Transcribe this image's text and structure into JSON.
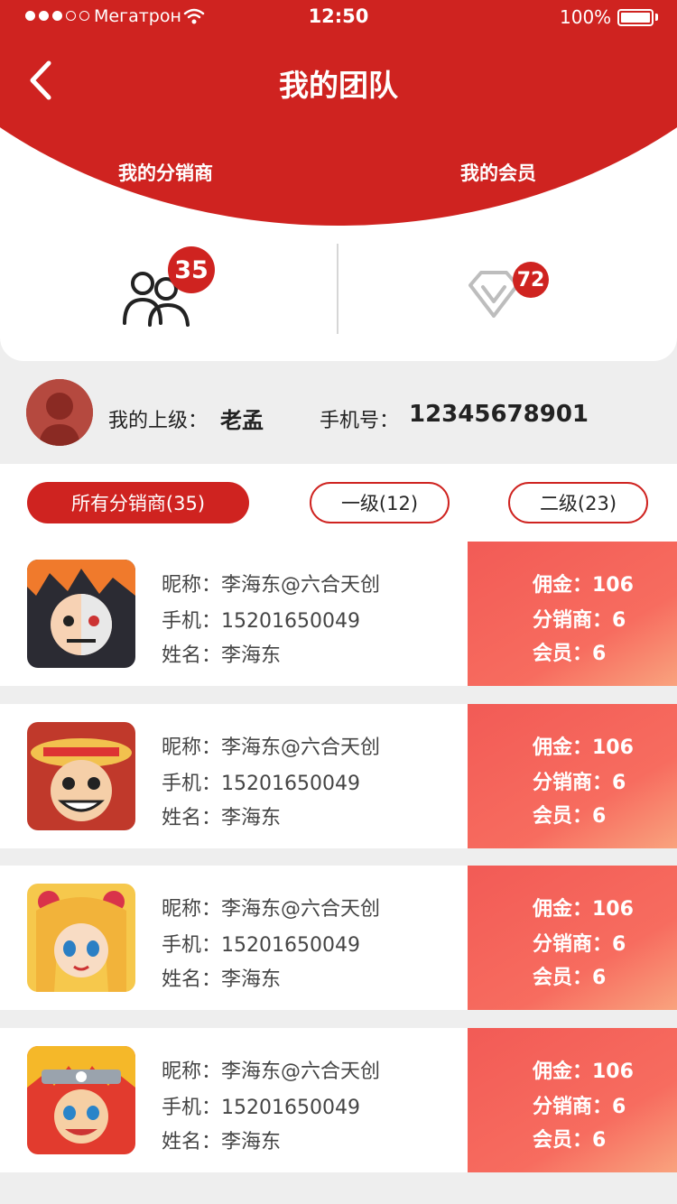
{
  "status_bar": {
    "carrier": "Мегатрон",
    "time": "12:50",
    "battery": "100%"
  },
  "header": {
    "title": "我的团队"
  },
  "tabs": {
    "distributors": {
      "label": "我的分销商",
      "count": "35"
    },
    "members": {
      "label": "我的会员",
      "count": "72"
    }
  },
  "superior": {
    "label": "我的上级：",
    "name": "老孟",
    "phone_label": "手机号：",
    "phone": "12345678901"
  },
  "filters": [
    "所有分销商(35)",
    "一级(12)",
    "二级(23)"
  ],
  "cards": [
    {
      "nickname": "昵称：李海东@六合天创",
      "phone": "手机：15201650049",
      "name": "姓名：李海东",
      "commission": "佣金：106",
      "distributors": "分销商：6",
      "members": "会员：6"
    },
    {
      "nickname": "昵称：李海东@六合天创",
      "phone": "手机：15201650049",
      "name": "姓名：李海东",
      "commission": "佣金：106",
      "distributors": "分销商：6",
      "members": "会员：6"
    },
    {
      "nickname": "昵称：李海东@六合天创",
      "phone": "手机：15201650049",
      "name": "姓名：李海东",
      "commission": "佣金：106",
      "distributors": "分销商：6",
      "members": "会员：6"
    },
    {
      "nickname": "昵称：李海东@六合天创",
      "phone": "手机：15201650049",
      "name": "姓名：李海东",
      "commission": "佣金：106",
      "distributors": "分销商：6",
      "members": "会员：6"
    }
  ],
  "colors": {
    "brand_red": "#cf2320",
    "text_dark": "#222222",
    "card_gradient_start": "#f25b56",
    "card_gradient_end": "#f9a37e"
  },
  "icons": [
    "signal-dots-icon",
    "wifi-icon",
    "battery-icon",
    "back-arrow-icon",
    "people-icon",
    "diamond-icon",
    "avatar-silhouette-icon"
  ]
}
